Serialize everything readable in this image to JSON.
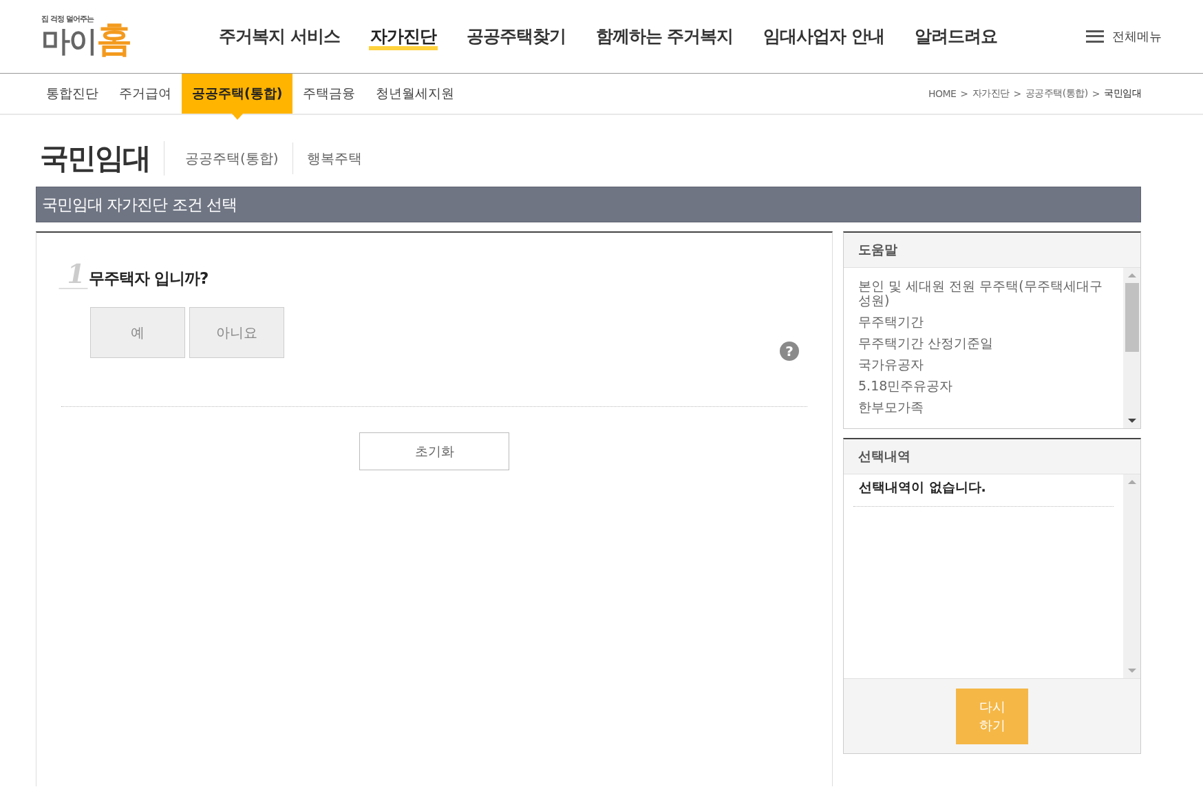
{
  "logo": {
    "tagline": "집 걱정 덜어주는",
    "name_main": "마이",
    "name_accent": "홈"
  },
  "main_nav": [
    {
      "label": "주거복지 서비스",
      "selected": false
    },
    {
      "label": "자가진단",
      "selected": true
    },
    {
      "label": "공공주택찾기",
      "selected": false
    },
    {
      "label": "함께하는 주거복지",
      "selected": false
    },
    {
      "label": "임대사업자 안내",
      "selected": false
    },
    {
      "label": "알려드려요",
      "selected": false
    }
  ],
  "all_menu": {
    "label": "전체메뉴"
  },
  "sub_nav": [
    {
      "label": "통합진단",
      "selected": false
    },
    {
      "label": "주거급여",
      "selected": false
    },
    {
      "label": "공공주택(통합)",
      "selected": true
    },
    {
      "label": "주택금융",
      "selected": false
    },
    {
      "label": "청년월세지원",
      "selected": false
    }
  ],
  "breadcrumb": [
    {
      "label": "HOME",
      "current": false
    },
    {
      "label": "자가진단",
      "current": false
    },
    {
      "label": "공공주택(통합)",
      "current": false
    },
    {
      "label": "국민임대",
      "current": true
    }
  ],
  "breadcrumb_separator": ">",
  "page_title": "국민임대",
  "page_links": [
    "공공주택(통합)",
    "행복주택"
  ],
  "section_bar": "국민임대 자가진단 조건 선택",
  "question": {
    "number": "1",
    "text": "무주택자 입니까?",
    "answers": [
      "예",
      "아니요"
    ],
    "help": "?"
  },
  "reset_button": "초기화",
  "help_panel": {
    "title": "도움말",
    "items": [
      "본인 및 세대원 전원 무주택(무주택세대구성원)",
      "무주택기간",
      "무주택기간 산정기준일",
      "국가유공자",
      "5.18민주유공자",
      "한부모가족"
    ]
  },
  "selection_panel": {
    "title": "선택내역",
    "empty_message": "선택내역이 없습니다.",
    "retry_button": "다시\n하기"
  }
}
